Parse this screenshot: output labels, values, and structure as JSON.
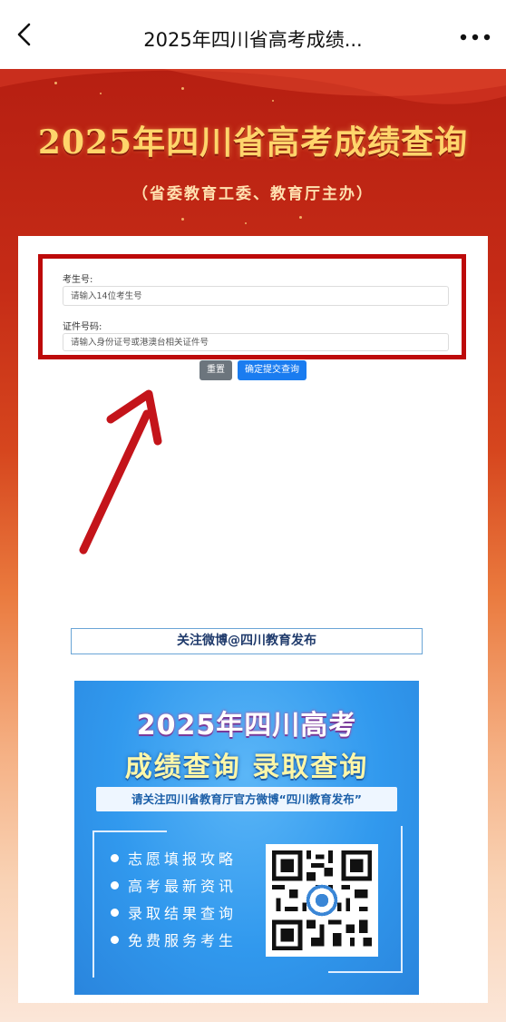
{
  "nav": {
    "title": "2025年四川省高考成绩...",
    "back_icon": "chevron-left-icon",
    "more_icon": "more-dots-icon"
  },
  "banner": {
    "title": "2025年四川省高考成绩查询",
    "subtitle": "（省委教育工委、教育厅主办）"
  },
  "form": {
    "exam_number_label": "考生号:",
    "exam_number_placeholder": "请输入14位考生号",
    "id_number_label": "证件号码:",
    "id_number_placeholder": "请输入身份证号或港澳台相关证件号",
    "reset_label": "重置",
    "submit_label": "确定提交查询"
  },
  "follow": {
    "text": "关注微博@四川教育发布"
  },
  "poster": {
    "title_line1": "2025年四川高考",
    "title_line2": "成绩查询 录取查询",
    "ribbon": "请关注四川省教育厅官方微博“四川教育发布”",
    "bullets": [
      "志愿填报攻略",
      "高考最新资讯",
      "录取结果查询",
      "免费服务考生"
    ]
  },
  "colors": {
    "highlight_border": "#bd0a0a",
    "submit_button": "#1a7cf0",
    "reset_button": "#6c757d",
    "banner_title": "#ffd56b",
    "poster_blue": "#3199ee"
  }
}
